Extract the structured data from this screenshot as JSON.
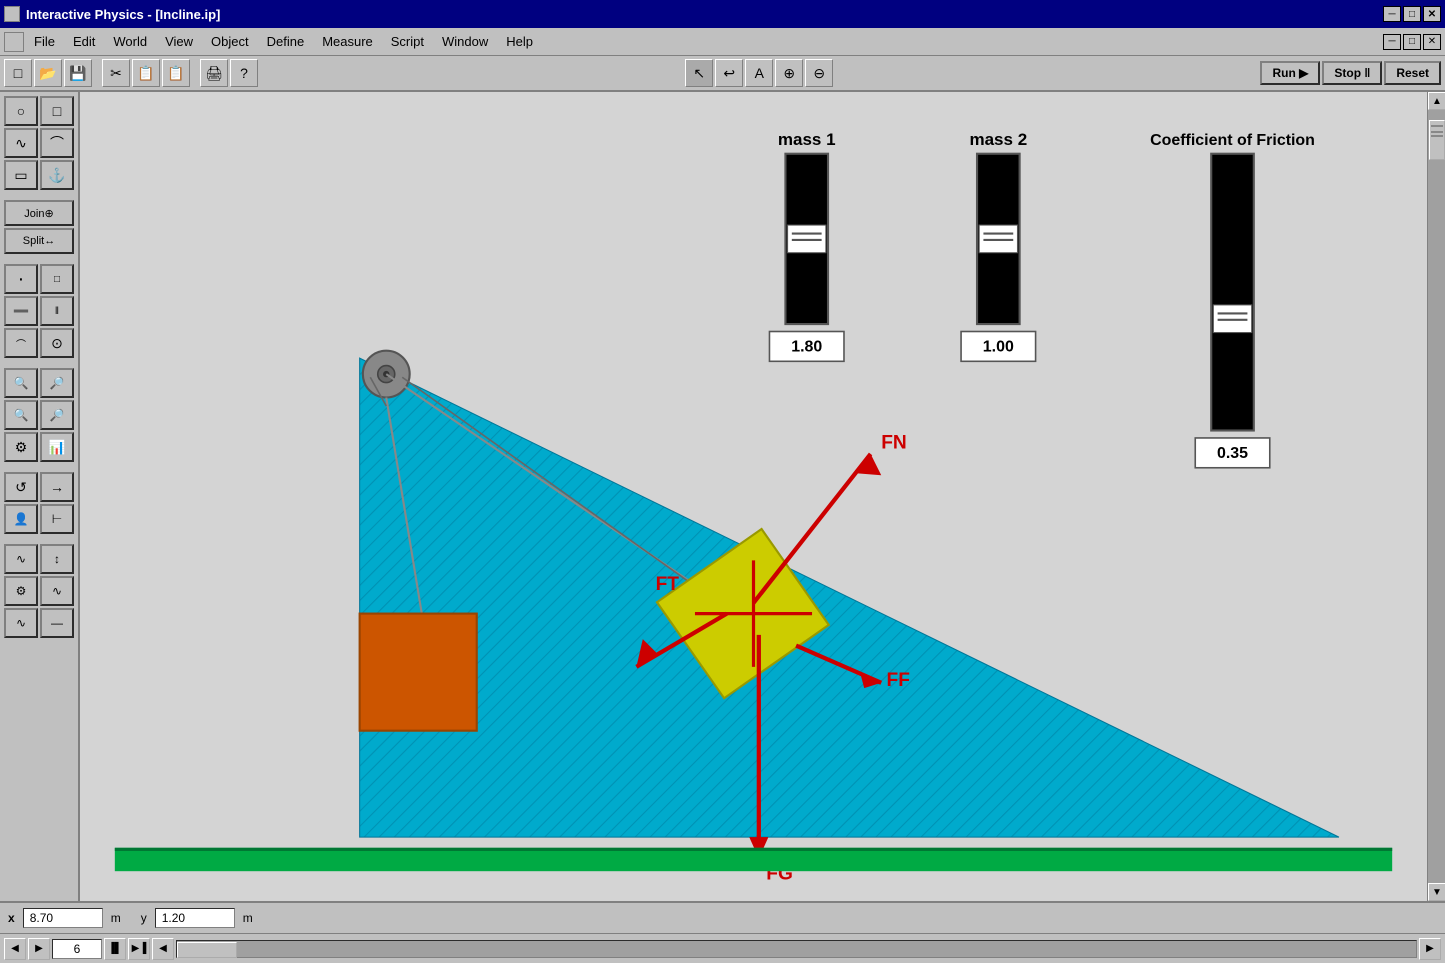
{
  "app": {
    "title": "Interactive Physics - [Incline.ip]"
  },
  "titlebar": {
    "title": "Interactive Physics - [Incline.ip]",
    "minimize": "─",
    "maximize": "□",
    "close": "✕"
  },
  "menubar": {
    "items": [
      {
        "label": "File"
      },
      {
        "label": "Edit"
      },
      {
        "label": "World"
      },
      {
        "label": "View"
      },
      {
        "label": "Object"
      },
      {
        "label": "Define"
      },
      {
        "label": "Measure"
      },
      {
        "label": "Script"
      },
      {
        "label": "Window"
      },
      {
        "label": "Help"
      }
    ]
  },
  "toolbar": {
    "run_label": "Run ▶",
    "stop_label": "Stop ‖",
    "reset_label": "Reset"
  },
  "sliders": {
    "mass1": {
      "label": "mass 1",
      "value": "1.80"
    },
    "mass2": {
      "label": "mass 2",
      "value": "1.00"
    },
    "friction": {
      "label": "Coefficient of Friction",
      "value": "0.35"
    }
  },
  "forces": {
    "FN": "FN",
    "FT": "FT",
    "FF": "FF",
    "FG": "FG"
  },
  "status": {
    "x_label": "x",
    "x_value": "8.70",
    "x_unit": "m",
    "y_label": "y",
    "y_value": "1.20",
    "y_unit": "m"
  },
  "playback": {
    "frame": "6"
  },
  "toolbar_icons": {
    "new": "□",
    "open": "📁",
    "save": "💾",
    "cut": "✂",
    "copy": "📋",
    "paste": "📋",
    "print": "🖨",
    "help": "?",
    "pointer": "↖",
    "undo": "↩",
    "text": "A",
    "zoom_in": "🔍",
    "zoom_out": "🔍"
  },
  "left_tools": [
    {
      "icon": "○",
      "name": "circle-tool"
    },
    {
      "icon": "□",
      "name": "rect-tool"
    },
    {
      "icon": "∿",
      "name": "curve-tool"
    },
    {
      "icon": "⌒",
      "name": "arc-tool"
    },
    {
      "icon": "▭",
      "name": "box-tool"
    },
    {
      "icon": "⚓",
      "name": "anchor-tool"
    },
    {
      "icon": "Join⊕",
      "name": "join-tool",
      "wide": true
    },
    {
      "icon": "Split↔",
      "name": "split-tool",
      "wide": true
    },
    {
      "icon": "·",
      "name": "point-tool"
    },
    {
      "icon": "□",
      "name": "small-rect-tool"
    },
    {
      "icon": "═",
      "name": "spring-tool"
    },
    {
      "icon": "‖",
      "name": "damper-tool"
    },
    {
      "icon": "⌒",
      "name": "rope-tool"
    },
    {
      "icon": "⊙",
      "name": "circle2-tool"
    },
    {
      "icon": "🔍",
      "name": "zoom2-tool"
    },
    {
      "icon": "🔎",
      "name": "zoom3-tool"
    },
    {
      "icon": "🔍",
      "name": "zoom4-tool"
    },
    {
      "icon": "🔎",
      "name": "zoom5-tool"
    },
    {
      "icon": "⚙",
      "name": "settings-tool"
    },
    {
      "icon": "≡",
      "name": "menu2-tool"
    },
    {
      "icon": "↺",
      "name": "rotate-tool"
    },
    {
      "icon": "→",
      "name": "arrow-tool"
    },
    {
      "icon": "👤",
      "name": "person-tool"
    },
    {
      "icon": "⊢",
      "name": "force-tool"
    },
    {
      "icon": "∿",
      "name": "wave-tool"
    },
    {
      "icon": "↕",
      "name": "measure-tool"
    },
    {
      "icon": "⚙",
      "name": "gear-tool"
    },
    {
      "icon": "📊",
      "name": "chart-tool"
    },
    {
      "icon": "∿",
      "name": "wave2-tool"
    },
    {
      "icon": "—",
      "name": "line-tool"
    }
  ],
  "colors": {
    "background": "#d4d4d4",
    "incline_fill": "#00aacc",
    "ground_fill": "#00aa44",
    "block_fill": "#cccc00",
    "hanging_block_fill": "#cc5500",
    "force_arrow": "#cc0000",
    "title_bar": "#000080",
    "menu_bg": "#c0c0c0"
  }
}
